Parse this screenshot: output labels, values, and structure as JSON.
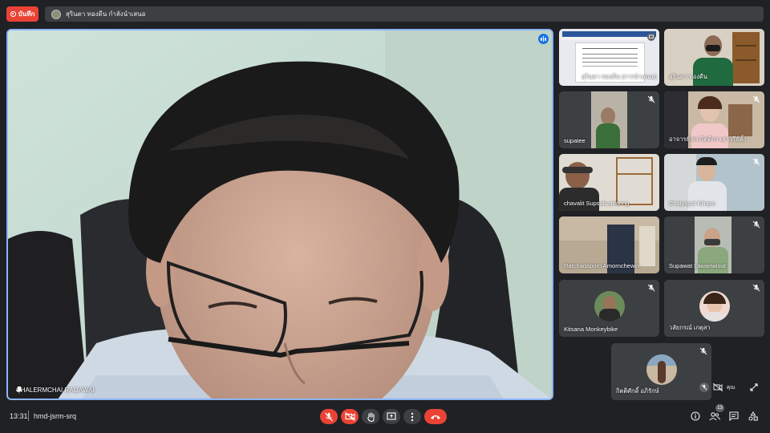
{
  "recording": {
    "label": "บันทึก"
  },
  "presenter": {
    "text": "สุรินดา ทองดีน กำลังนำเสนอ"
  },
  "main_speaker": {
    "name": "CHALERMCHAI RAIJAWAI"
  },
  "tiles": [
    {
      "name": "สุรินดา ทองดีน (การนำเสนอ)"
    },
    {
      "name": "สุรินดา ทองดีน"
    },
    {
      "name": "supatee"
    },
    {
      "name": "อาจารย์ ดร.กิตติกร เสาวรีย์ตั้ง"
    },
    {
      "name": "chavalit Supsakvarlaong"
    },
    {
      "name": "Chalyapol Klinjan"
    },
    {
      "name": "Ratchadaporn Amornchewin"
    },
    {
      "name": "Supawat Lawanwisut"
    },
    {
      "name": "Kitsana Monkeybike"
    },
    {
      "name": "วลัยกรณ์ เกตุสา"
    },
    {
      "name": "กิตติศักดิ์ อภิรักษ์"
    }
  ],
  "self_view": {
    "label": "คุณ"
  },
  "footer": {
    "time": "13:31",
    "meeting_code": "hmd-jsrm-srq",
    "participant_count": "13"
  },
  "colors": {
    "accent": "#8ab4f8",
    "danger": "#ea4335",
    "panel": "#3c4043",
    "background": "#202124"
  }
}
